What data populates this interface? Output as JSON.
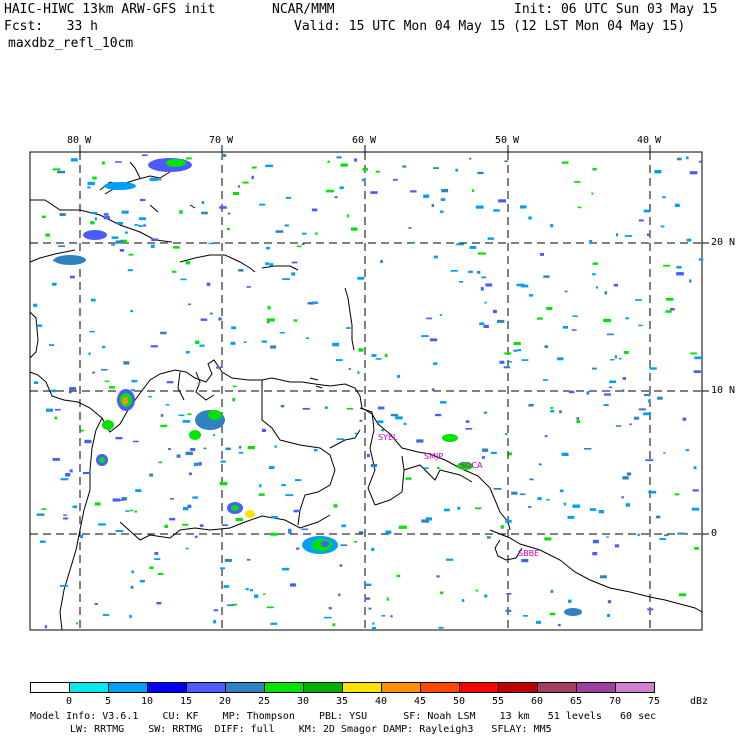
{
  "header": {
    "model": "HAIC-HIWC 13km ARW-GFS init",
    "org": "NCAR/MMM",
    "init": "Init: 06 UTC Sun 03 May 15",
    "fcst": "Fcst:   33 h",
    "valid": "Valid: 15 UTC Mon 04 May 15 (12 LST Mon 04 May 15)",
    "field": "maxdbz_refl_10cm"
  },
  "map": {
    "lon_labels": [
      "80 W",
      "70 W",
      "60 W",
      "50 W",
      "40 W"
    ],
    "lat_labels": [
      "20 N",
      "10 N",
      "0"
    ],
    "stations": [
      "SYEL",
      "SMJP",
      "SOCA",
      "SBBE"
    ]
  },
  "colorbar": {
    "unit": "dBz",
    "levels": [
      "0",
      "5",
      "10",
      "15",
      "20",
      "25",
      "30",
      "35",
      "40",
      "45",
      "50",
      "55",
      "60",
      "65",
      "70",
      "75"
    ],
    "colors": [
      "#ffffff",
      "#00ecec",
      "#01a0f6",
      "#0000f6",
      "#4a5cff",
      "#2e82c0",
      "#00e400",
      "#00b000",
      "#ffe300",
      "#ff9000",
      "#ff4800",
      "#ff0000",
      "#c00000",
      "#a04060",
      "#a040a0",
      "#d080d0"
    ]
  },
  "model_info": {
    "line1": "Model Info: V3.6.1    CU: KF    MP: Thompson    PBL: YSU      SF: Noah LSM    13 km   51 levels   60 sec",
    "line2": "LW: RRTMG    SW: RRTMG  DIFF: full    KM: 2D Smagor DAMP: Rayleigh3   SFLAY: MM5"
  }
}
